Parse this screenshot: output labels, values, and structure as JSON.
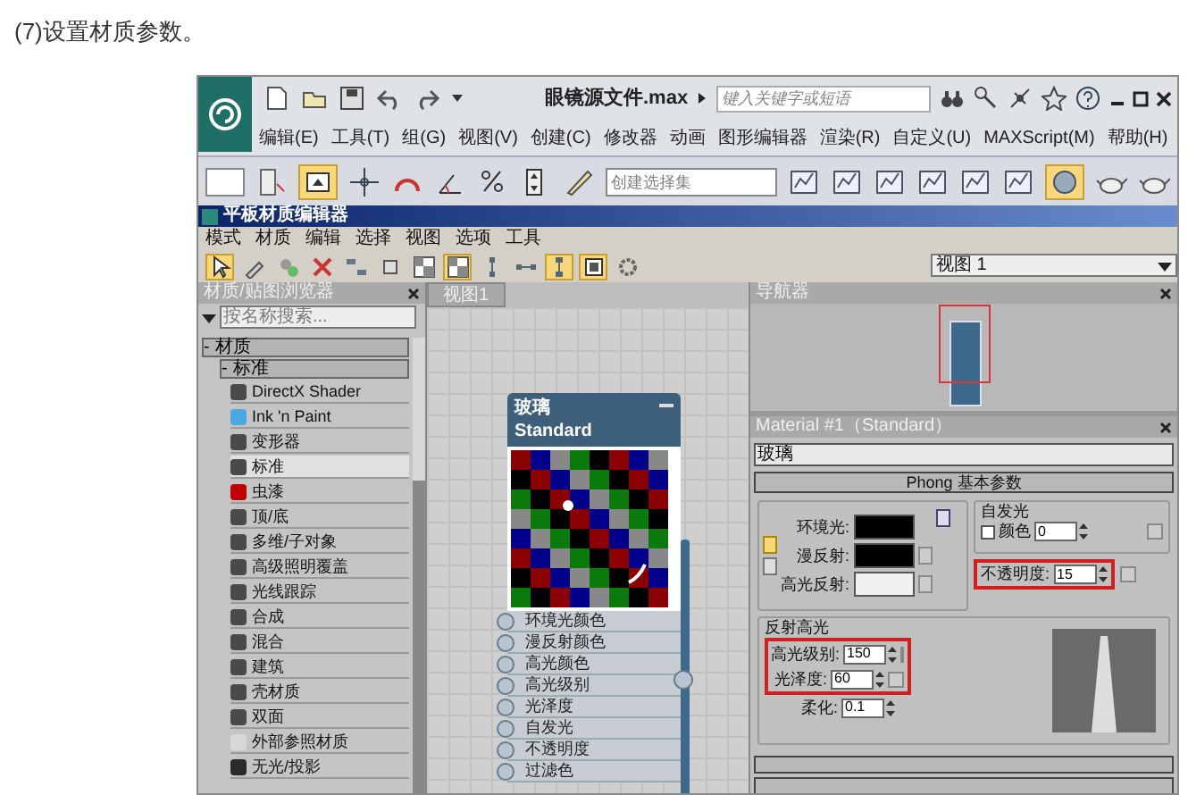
{
  "caption": "(7)设置材质参数。",
  "app": {
    "title": "眼镜源文件.max",
    "search": {
      "placeholder": "键入关键字或短语"
    },
    "menu": [
      "编辑(E)",
      "工具(T)",
      "组(G)",
      "视图(V)",
      "创建(C)",
      "修改器",
      "动画",
      "图形编辑器",
      "渲染(R)",
      "自定义(U)",
      "MAXScript(M)",
      "帮助(H)"
    ],
    "selection_set": {
      "placeholder": "创建选择集"
    }
  },
  "editor": {
    "title": "平板材质编辑器",
    "menu": [
      "模式",
      "材质",
      "编辑",
      "选择",
      "视图",
      "选项",
      "工具"
    ],
    "toolbar": [
      {
        "active": true
      },
      {
        "active": false
      },
      {
        "active": false
      },
      {
        "active": false
      },
      {
        "active": false
      },
      {
        "active": false
      },
      {
        "active": false
      },
      {
        "active": true
      },
      {
        "active": false
      },
      {
        "active": false
      },
      {
        "active": true
      },
      {
        "active": true
      },
      {
        "active": false
      }
    ]
  },
  "browser": {
    "title": "材质/贴图浏览器",
    "search": {
      "placeholder": "按名称搜索..."
    },
    "tree": [
      {
        "toggle": "-",
        "label": "材质",
        "children": [
          {
            "toggle": "-",
            "label": "标准",
            "children": [
              {
                "label": "DirectX Shader",
                "color": "#4a4a4a",
                "selected": false
              },
              {
                "label": "Ink 'n Paint",
                "color": "#4aa8e0",
                "selected": false
              },
              {
                "label": "变形器",
                "color": "#4a4a4a",
                "selected": false
              },
              {
                "label": "标准",
                "color": "#4a4a4a",
                "selected": true
              },
              {
                "label": "虫漆",
                "color": "#c00000",
                "selected": false
              },
              {
                "label": "顶/底",
                "color": "#4a4a4a",
                "selected": false
              },
              {
                "label": "多维/子对象",
                "color": "#4a4a4a",
                "selected": false
              },
              {
                "label": "高级照明覆盖",
                "color": "#4a4a4a",
                "selected": false
              },
              {
                "label": "光线跟踪",
                "color": "#4a4a4a",
                "selected": false
              },
              {
                "label": "合成",
                "color": "#4a4a4a",
                "selected": false
              },
              {
                "label": "混合",
                "color": "#4a4a4a",
                "selected": false
              },
              {
                "label": "建筑",
                "color": "#4a4a4a",
                "selected": false
              },
              {
                "label": "壳材质",
                "color": "#4a4a4a",
                "selected": false
              },
              {
                "label": "双面",
                "color": "#4a4a4a",
                "selected": false
              },
              {
                "label": "外部参照材质",
                "color": "#d8d8d8",
                "selected": false
              },
              {
                "label": "无光/投影",
                "color": "#2a2a2a",
                "selected": false
              }
            ]
          }
        ]
      }
    ]
  },
  "view": {
    "tab": "视图1",
    "node": {
      "title": "玻璃",
      "subtitle": "Standard",
      "slots": [
        "环境光颜色",
        "漫反射颜色",
        "高光颜色",
        "高光级别",
        "光泽度",
        "自发光",
        "不透明度",
        "过滤色"
      ]
    }
  },
  "view_select": "视图 1",
  "navigator": {
    "title": "导航器"
  },
  "params": {
    "title": "Material #1（Standard）",
    "name": "玻璃",
    "rollout": "Phong 基本参数",
    "colors": [
      {
        "label": "环境光:",
        "color": "#000000"
      },
      {
        "label": "漫反射:",
        "color": "#000000"
      },
      {
        "label": "高光反射:",
        "color": "#f0f0f0"
      }
    ],
    "self_illum": {
      "title": "自发光",
      "label": "颜色",
      "checked": false,
      "value": "0"
    },
    "opacity": {
      "label": "不透明度:",
      "value": "15",
      "highlighted": true
    },
    "specular": {
      "title": "反射高光",
      "fields": [
        {
          "label": "高光级别:",
          "value": "150",
          "highlighted": true
        },
        {
          "label": "光泽度:",
          "value": "60",
          "highlighted": true
        },
        {
          "label": "柔化:",
          "value": "0.1",
          "highlighted": false
        }
      ]
    }
  }
}
